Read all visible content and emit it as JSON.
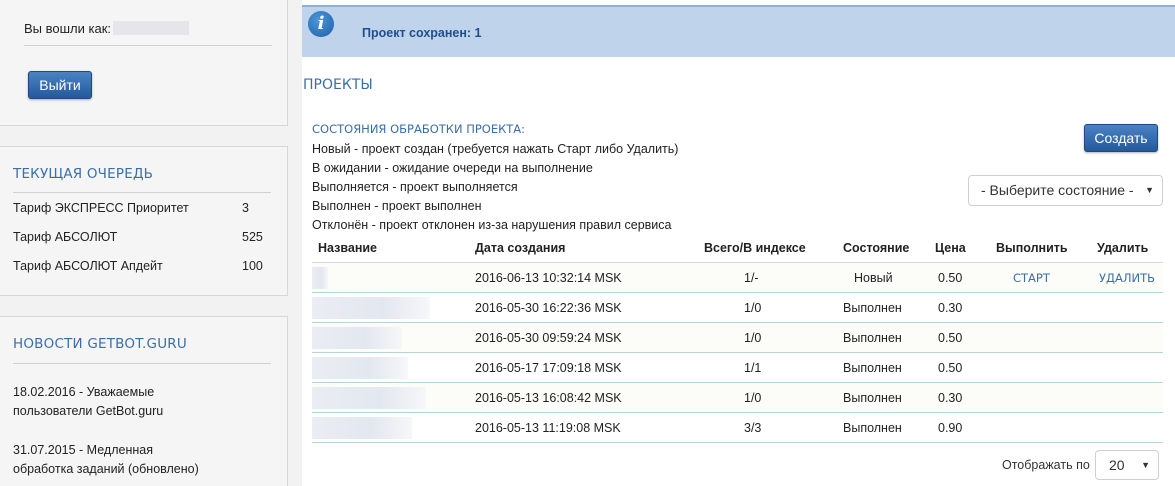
{
  "sidebar": {
    "login_text": "Вы вошли как:",
    "logout_label": "Выйти",
    "queue": {
      "title": "ТЕКУЩАЯ ОЧЕРЕДЬ",
      "rows": [
        {
          "name": "Тариф ЭКСПРЕСС Приоритет",
          "count": "3"
        },
        {
          "name": "Тариф АБСОЛЮТ",
          "count": "525"
        },
        {
          "name": "Тариф АБСОЛЮТ Апдейт",
          "count": "100"
        }
      ]
    },
    "news": {
      "title": "НОВОСТИ GETBOT.GURU",
      "items": [
        {
          "line1": "18.02.2016 - Уважаемые",
          "line2": "пользователи GetBot.guru"
        },
        {
          "line1": "31.07.2015 - Медленная",
          "line2": "обработка заданий (обновлено)"
        }
      ]
    }
  },
  "alert": {
    "icon": "info-icon",
    "text": "Проект сохранен: 1"
  },
  "main": {
    "title": "ПРОЕКТЫ",
    "states_title": "СОСТОЯНИЯ ОБРАБОТКИ ПРОЕКТА:",
    "states": [
      "Новый - проект создан (требуется нажать Старт либо Удалить)",
      "В ожидании - ожидание очереди на выполнение",
      "Выполняется - проект выполняется",
      "Выполнен - проект выполнен",
      "Отклонён - проект отклонен из-за нарушения правил сервиса"
    ],
    "create_label": "Создать",
    "state_select": "- Выберите состояние -",
    "table": {
      "headers": {
        "name": "Название",
        "date": "Дата создания",
        "index": "Всего/В индексе",
        "state": "Состояние",
        "price": "Цена",
        "run": "Выполнить",
        "delete": "Удалить"
      },
      "rows": [
        {
          "date": "2016-06-13 10:32:14 MSK",
          "index": "1/-",
          "state": "Новый",
          "price": "0.50",
          "run": "СТАРТ",
          "delete": "УДАЛИТЬ"
        },
        {
          "date": "2016-05-30 16:22:36 MSK",
          "index": "1/0",
          "state": "Выполнен",
          "price": "0.30",
          "run": "",
          "delete": ""
        },
        {
          "date": "2016-05-30 09:59:24 MSK",
          "index": "1/0",
          "state": "Выполнен",
          "price": "0.50",
          "run": "",
          "delete": ""
        },
        {
          "date": "2016-05-17 17:09:18 MSK",
          "index": "1/1",
          "state": "Выполнен",
          "price": "0.50",
          "run": "",
          "delete": ""
        },
        {
          "date": "2016-05-13 16:08:42 MSK",
          "index": "1/0",
          "state": "Выполнен",
          "price": "0.30",
          "run": "",
          "delete": ""
        },
        {
          "date": "2016-05-13 11:19:08 MSK",
          "index": "3/3",
          "state": "Выполнен",
          "price": "0.90",
          "run": "",
          "delete": ""
        }
      ]
    },
    "per_page_label": "Отображать по",
    "per_page_value": "20"
  }
}
